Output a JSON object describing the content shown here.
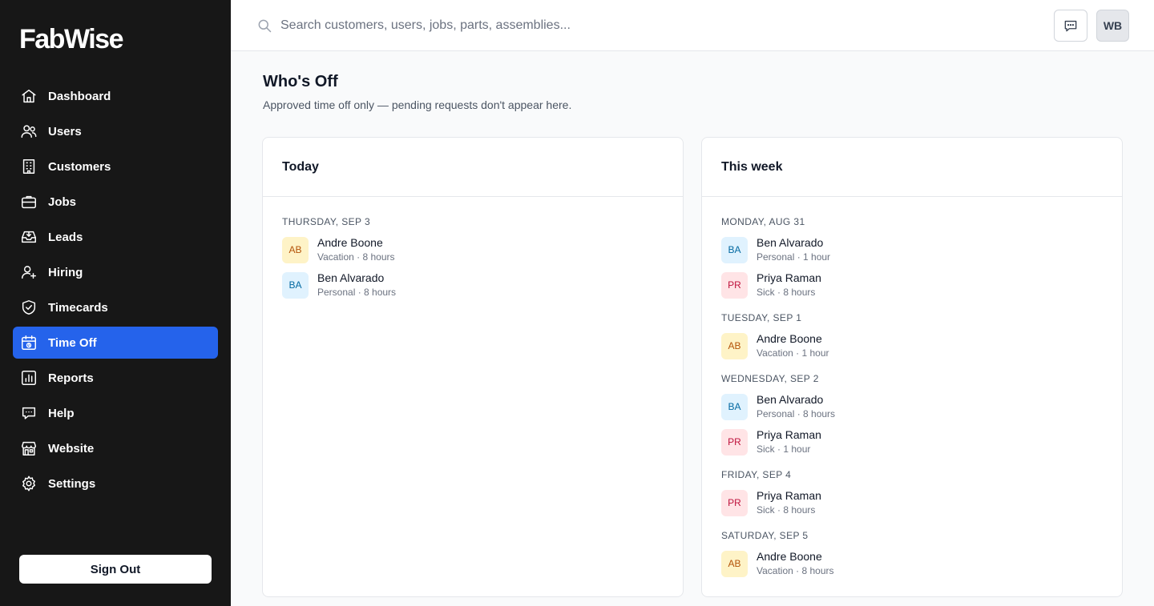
{
  "app": {
    "logo": "FabWise"
  },
  "sidebar": {
    "items": [
      {
        "label": "Dashboard",
        "icon": "home-icon",
        "active": false
      },
      {
        "label": "Users",
        "icon": "users-icon",
        "active": false
      },
      {
        "label": "Customers",
        "icon": "building-icon",
        "active": false
      },
      {
        "label": "Jobs",
        "icon": "briefcase-icon",
        "active": false
      },
      {
        "label": "Leads",
        "icon": "inbox-icon",
        "active": false
      },
      {
        "label": "Hiring",
        "icon": "user-plus-icon",
        "active": false
      },
      {
        "label": "Timecards",
        "icon": "shield-check-icon",
        "active": false
      },
      {
        "label": "Time Off",
        "icon": "calendar-clock-icon",
        "active": true
      },
      {
        "label": "Reports",
        "icon": "bar-chart-icon",
        "active": false
      },
      {
        "label": "Help",
        "icon": "chat-bubble-icon",
        "active": false
      },
      {
        "label": "Website",
        "icon": "storefront-icon",
        "active": false
      },
      {
        "label": "Settings",
        "icon": "gear-icon",
        "active": false
      }
    ],
    "signout_label": "Sign Out"
  },
  "topbar": {
    "search_placeholder": "Search customers, users, jobs, parts, assemblies...",
    "search_value": "",
    "avatar_initials": "WB"
  },
  "page": {
    "title": "Who's Off",
    "subtitle": "Approved time off only — pending requests don't appear here."
  },
  "colors": {
    "sidebar_bg": "#171717",
    "accent": "#2563eb",
    "badge_amber": "#fef3c7",
    "badge_sky": "#e0f2fe",
    "badge_rose": "#ffe4e6"
  },
  "today": {
    "title": "Today",
    "groups": [
      {
        "day": "THURSDAY, SEP 3",
        "entries": [
          {
            "initials": "AB",
            "name": "Andre Boone",
            "detail": "Vacation · 8 hours",
            "color": "amber"
          },
          {
            "initials": "BA",
            "name": "Ben Alvarado",
            "detail": "Personal · 8 hours",
            "color": "sky"
          }
        ]
      }
    ]
  },
  "week": {
    "title": "This week",
    "groups": [
      {
        "day": "MONDAY, AUG 31",
        "entries": [
          {
            "initials": "BA",
            "name": "Ben Alvarado",
            "detail": "Personal · 1 hour",
            "color": "sky"
          },
          {
            "initials": "PR",
            "name": "Priya Raman",
            "detail": "Sick · 8 hours",
            "color": "rose"
          }
        ]
      },
      {
        "day": "TUESDAY, SEP 1",
        "entries": [
          {
            "initials": "AB",
            "name": "Andre Boone",
            "detail": "Vacation · 1 hour",
            "color": "amber"
          }
        ]
      },
      {
        "day": "WEDNESDAY, SEP 2",
        "entries": [
          {
            "initials": "BA",
            "name": "Ben Alvarado",
            "detail": "Personal · 8 hours",
            "color": "sky"
          },
          {
            "initials": "PR",
            "name": "Priya Raman",
            "detail": "Sick · 1 hour",
            "color": "rose"
          }
        ]
      },
      {
        "day": "FRIDAY, SEP 4",
        "entries": [
          {
            "initials": "PR",
            "name": "Priya Raman",
            "detail": "Sick · 8 hours",
            "color": "rose"
          }
        ]
      },
      {
        "day": "SATURDAY, SEP 5",
        "entries": [
          {
            "initials": "AB",
            "name": "Andre Boone",
            "detail": "Vacation · 8 hours",
            "color": "amber"
          }
        ]
      }
    ]
  }
}
